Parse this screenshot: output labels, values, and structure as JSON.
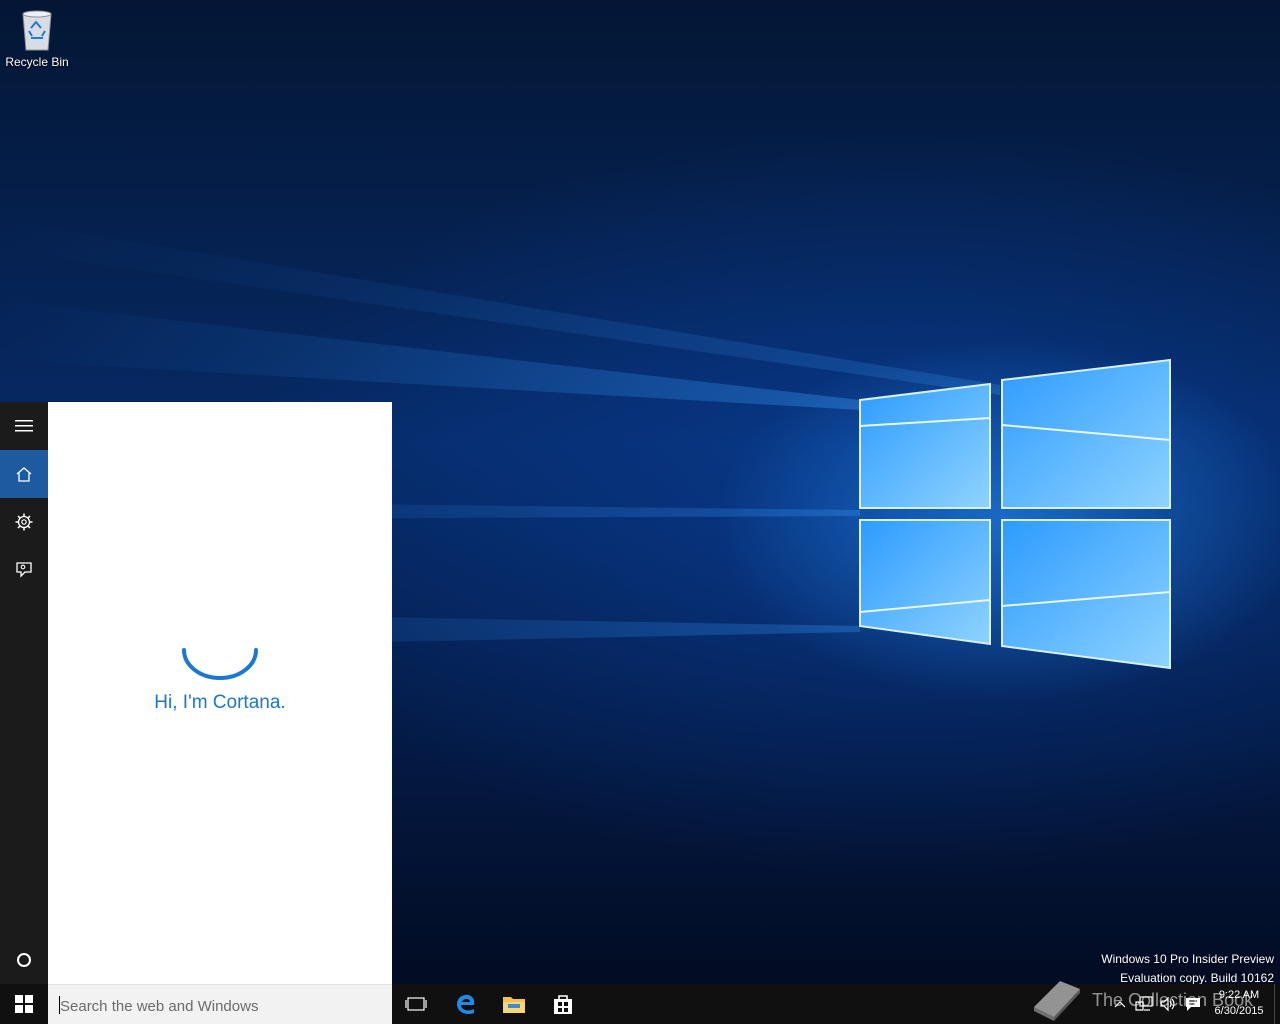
{
  "desktop": {
    "icons": [
      {
        "label": "Recycle Bin",
        "icon": "recycle-bin-icon"
      }
    ],
    "watermark": {
      "line1": "Windows 10 Pro Insider Preview",
      "line2": "Evaluation copy. Build 10162"
    },
    "brand_overlay": "The Collection Book"
  },
  "cortana": {
    "rail": [
      {
        "name": "menu",
        "icon": "hamburger-icon"
      },
      {
        "name": "home",
        "icon": "home-icon",
        "active": true
      },
      {
        "name": "notebook-settings",
        "icon": "gear-icon"
      },
      {
        "name": "feedback",
        "icon": "feedback-icon"
      }
    ],
    "bottom_icon": "cortana-circle-icon",
    "greeting": "Hi, I'm Cortana.",
    "accent": "#1a77d2"
  },
  "taskbar": {
    "search": {
      "placeholder": "Search the web and Windows",
      "value": ""
    },
    "pinned": [
      {
        "name": "task-view",
        "icon": "task-view-icon"
      },
      {
        "name": "edge",
        "icon": "edge-icon"
      },
      {
        "name": "file-explorer",
        "icon": "folder-icon"
      },
      {
        "name": "store",
        "icon": "store-icon"
      }
    ],
    "tray": {
      "icons": [
        "chevron-up-icon",
        "network-icon",
        "volume-icon",
        "action-center-icon"
      ],
      "time": "9:22 AM",
      "date": "6/30/2015"
    }
  }
}
